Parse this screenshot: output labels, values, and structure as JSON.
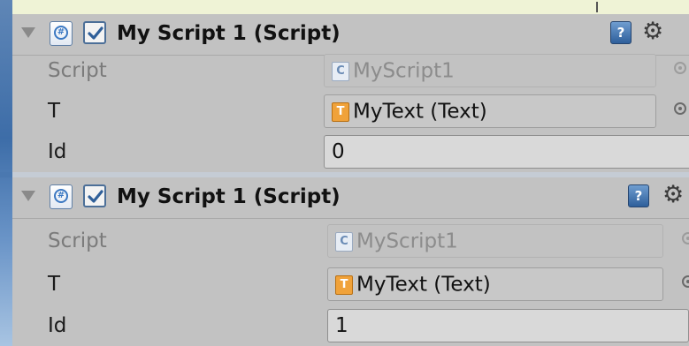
{
  "components": [
    {
      "title": "My Script 1 (Script)",
      "enabled": true,
      "fields": [
        {
          "label": "Script",
          "value": "MyScript1",
          "kind": "script-ref",
          "icon": "csharp-script-icon",
          "disabled": true
        },
        {
          "label": "T",
          "value": "MyText (Text)",
          "kind": "object-ref",
          "icon": "text-component-icon",
          "disabled": false
        },
        {
          "label": "Id",
          "value": "0",
          "kind": "int",
          "disabled": false
        }
      ]
    },
    {
      "title": "My Script 1 (Script)",
      "enabled": true,
      "fields": [
        {
          "label": "Script",
          "value": "MyScript1",
          "kind": "script-ref",
          "icon": "csharp-script-icon",
          "disabled": true
        },
        {
          "label": "T",
          "value": "MyText (Text)",
          "kind": "object-ref",
          "icon": "text-component-icon",
          "disabled": false
        },
        {
          "label": "Id",
          "value": "1",
          "kind": "int",
          "disabled": false
        }
      ]
    }
  ],
  "icons": {
    "fold": "foldout-triangle-icon",
    "script": "csharp-icon",
    "help": "help-book-icon",
    "settings": "gear-icon",
    "picker": "object-picker-icon"
  },
  "colors": {
    "panel": "#c2c2c2",
    "checkbox_border": "#4c6f98",
    "text_icon": "#f0a23a"
  }
}
